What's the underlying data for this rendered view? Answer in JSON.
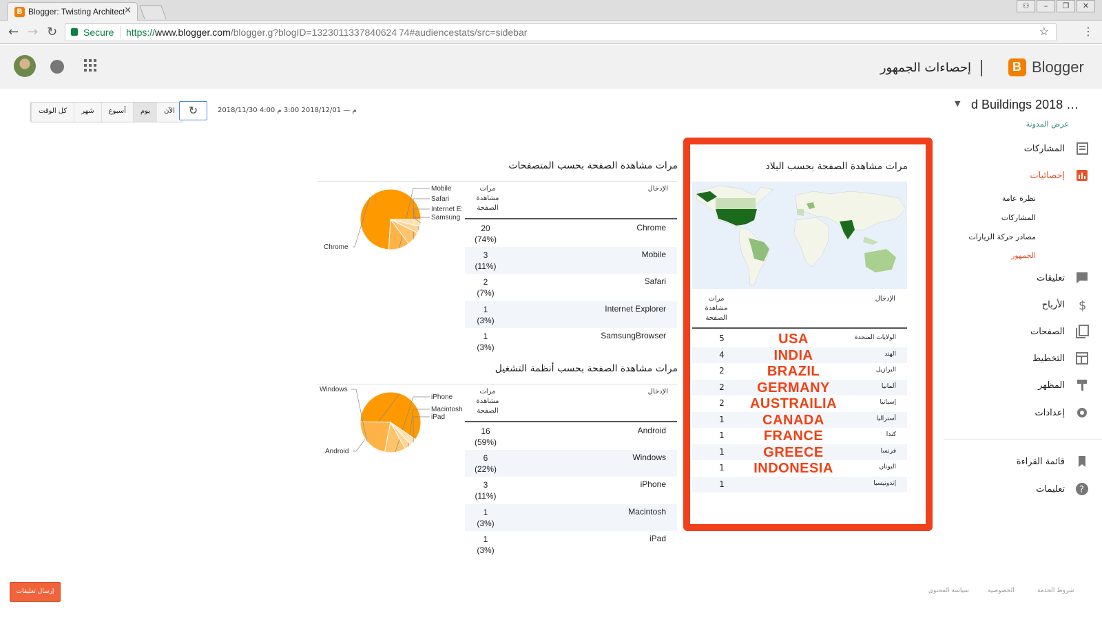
{
  "browser": {
    "tab_title": "Blogger: Twisting Architectu",
    "tab_favicon": "B",
    "close_glyph": "✕",
    "secure_label": "Secure",
    "url_scheme": "https://",
    "url_host": "www.blogger.com",
    "url_rest": "/blogger.g?blogID=1323011337840624 74#audiencestats/src=sidebar",
    "window_buttons": [
      "⚇",
      "–",
      "❐",
      "✕"
    ]
  },
  "header": {
    "brand": "Blogger",
    "page_title": "إحصاءات الجمهور"
  },
  "toolbar": {
    "range_buttons": [
      "الآن",
      "يوم",
      "أسبوع",
      "شهر",
      "كل الوقت"
    ],
    "active_index": 1,
    "refresh_glyph": "↻",
    "date_range": "2018/11/30 4:00 م — 2018/12/01 3:00 م"
  },
  "blog": {
    "name": "d Buildings 2018 …",
    "view_link": "عرض المدونة"
  },
  "sidebar": {
    "items": [
      {
        "label": "المشاركات",
        "icon": "posts-icon"
      },
      {
        "label": "إحصائيات",
        "icon": "stats-icon",
        "active": true
      },
      {
        "label": "تعليقات",
        "icon": "comments-icon"
      },
      {
        "label": "الأرباح",
        "icon": "earnings-icon"
      },
      {
        "label": "الصفحات",
        "icon": "pages-icon"
      },
      {
        "label": "التخطيط",
        "icon": "layout-icon"
      },
      {
        "label": "المظهر",
        "icon": "theme-icon"
      },
      {
        "label": "إعدادات",
        "icon": "settings-icon"
      },
      {
        "label": "قائمة القراءة",
        "icon": "reading-list-icon"
      },
      {
        "label": "تعليمات",
        "icon": "help-icon"
      }
    ],
    "sub_items": [
      "نظرة عامة",
      "المشاركات",
      "مصادر حركة الزيارات",
      "الجمهور"
    ],
    "sub_active_index": 3
  },
  "countries": {
    "title": "مرات مشاهدة الصفحة بحسب البلاد",
    "col_entry": "الإدخال",
    "col_views": "مرات مشاهدة الصفحة",
    "rows": [
      {
        "label": "الولايات المتحدة",
        "value": "5",
        "annotation": "USA"
      },
      {
        "label": "الهند",
        "value": "4",
        "annotation": "INDIA"
      },
      {
        "label": "البرازيل",
        "value": "2",
        "annotation": "BRAZIL"
      },
      {
        "label": "ألمانيا",
        "value": "2",
        "annotation": "GERMANY"
      },
      {
        "label": "إسبانيا",
        "value": "2",
        "annotation": "AUSTRAILIA"
      },
      {
        "label": "أستراليا",
        "value": "1",
        "annotation": "CANADA"
      },
      {
        "label": "كندا",
        "value": "1",
        "annotation": "FRANCE"
      },
      {
        "label": "فرنسا",
        "value": "1",
        "annotation": "GREECE"
      },
      {
        "label": "اليونان",
        "value": "1",
        "annotation": "INDONESIA"
      },
      {
        "label": "إندونيسيا",
        "value": "1",
        "annotation": ""
      }
    ]
  },
  "browsers": {
    "title": "مرات مشاهدة الصفحة بحسب المتصفحات",
    "col_entry": "الإدخال",
    "col_views": "مرات مشاهدة الصفحة",
    "rows": [
      {
        "name": "Chrome",
        "count": "20",
        "pct": "(74%)"
      },
      {
        "name": "Mobile",
        "count": "3",
        "pct": "(11%)"
      },
      {
        "name": "Safari",
        "count": "2",
        "pct": "(7%)"
      },
      {
        "name": "Internet Explorer",
        "count": "1",
        "pct": "(3%)"
      },
      {
        "name": "SamsungBrowser",
        "count": "1",
        "pct": "(3%)"
      }
    ]
  },
  "os": {
    "title": "مرات مشاهدة الصفحة بحسب أنظمة التشغيل",
    "col_entry": "الإدخال",
    "col_views": "مرات مشاهدة الصفحة",
    "rows": [
      {
        "name": "Android",
        "count": "16",
        "pct": "(59%)"
      },
      {
        "name": "Windows",
        "count": "6",
        "pct": "(22%)"
      },
      {
        "name": "iPhone",
        "count": "3",
        "pct": "(11%)"
      },
      {
        "name": "Macintosh",
        "count": "1",
        "pct": "(3%)"
      },
      {
        "name": "iPad",
        "count": "1",
        "pct": "(3%)"
      }
    ]
  },
  "chart_data": [
    {
      "type": "pie",
      "categories": [
        "Chrome",
        "Mobile",
        "Safari",
        "Internet E:",
        "Samsung"
      ],
      "values": [
        20,
        3,
        2,
        1,
        1
      ],
      "colors": [
        "#ff9900",
        "#ffb347",
        "#ffc46b",
        "#ffd494",
        "#ffe2b5"
      ]
    },
    {
      "type": "pie",
      "categories": [
        "Android",
        "Windows",
        "iPhone",
        "Macintosh",
        "iPad"
      ],
      "values": [
        16,
        6,
        3,
        1,
        1
      ],
      "colors": [
        "#ff9900",
        "#ffb347",
        "#ffc46b",
        "#ffd494",
        "#ffe2b5"
      ]
    }
  ],
  "footer": {
    "send_feedback": "إرسال تعليقات",
    "links": [
      "شروط الخدمة",
      "الخصوصية",
      "سياسة المحتوى"
    ]
  }
}
